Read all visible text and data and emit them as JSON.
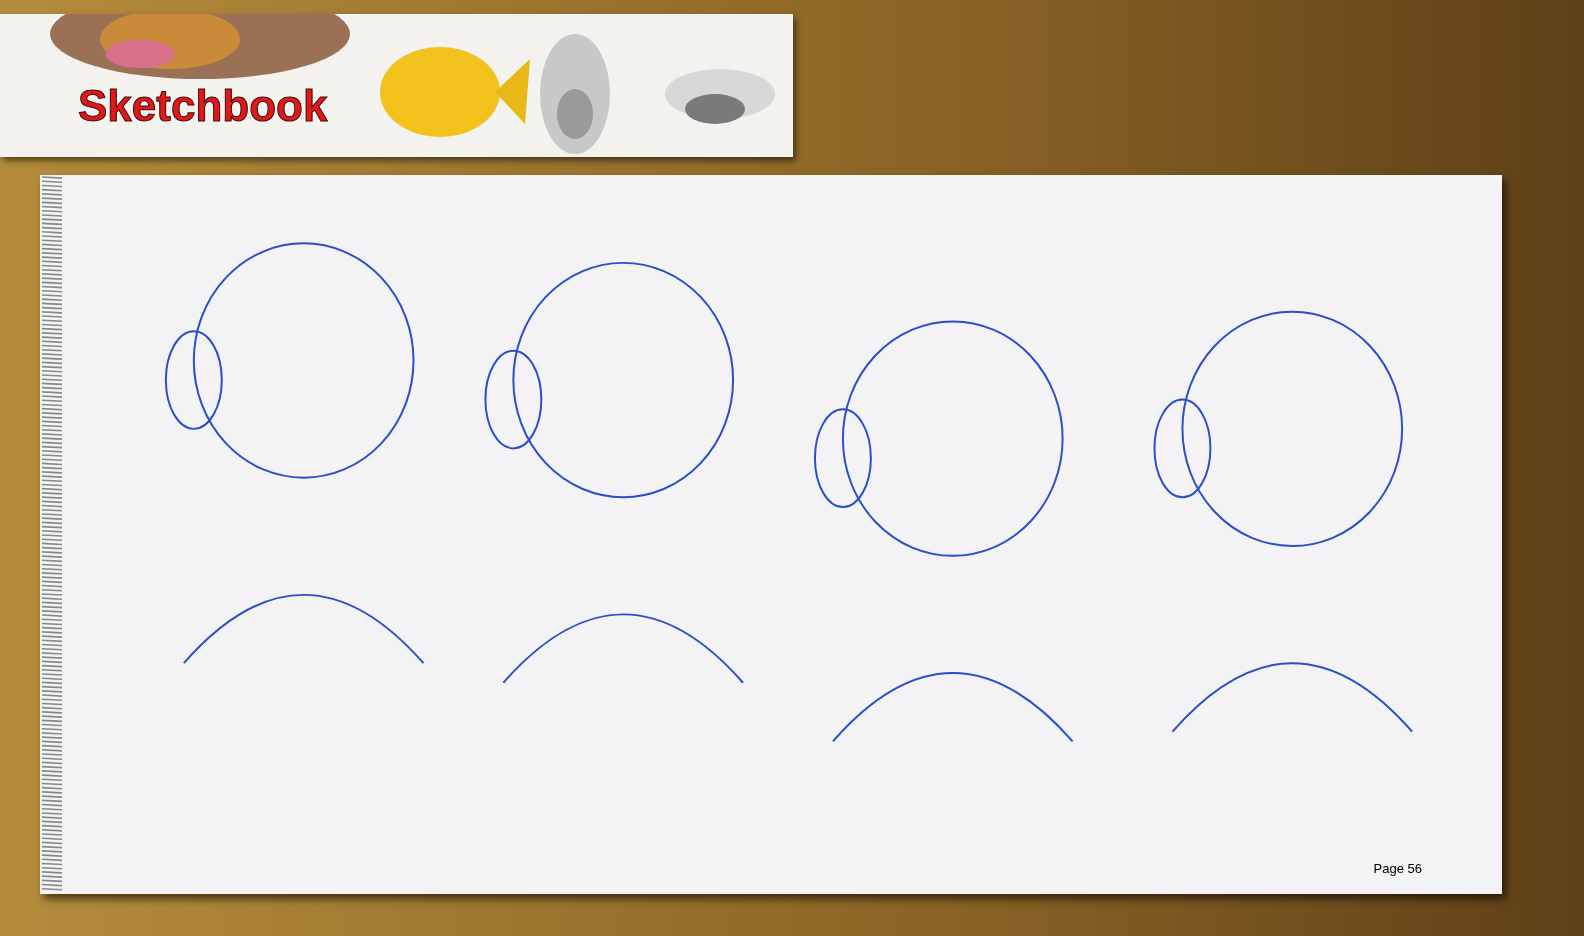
{
  "header": {
    "title": "Sketchbook"
  },
  "page": {
    "page_number": "Page 56"
  }
}
